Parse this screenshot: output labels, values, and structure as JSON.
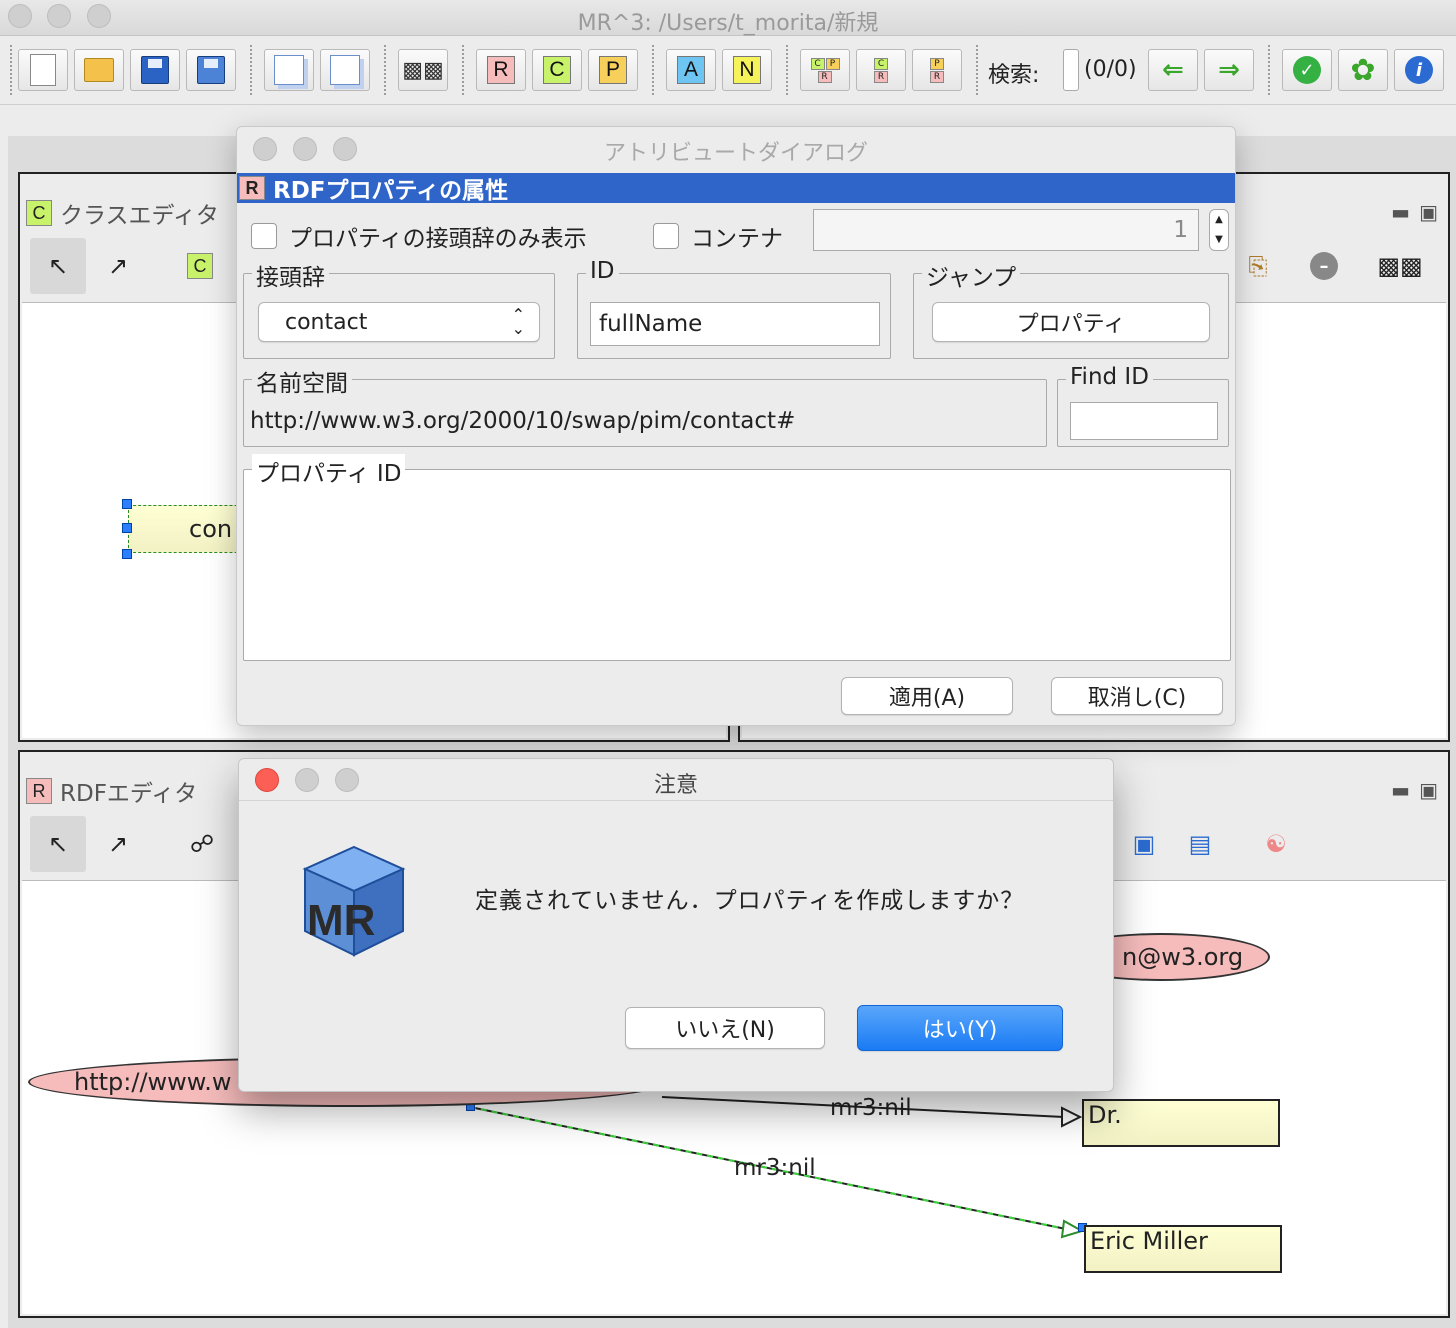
{
  "window": {
    "title": "MR^3: /Users/t_morita/新規"
  },
  "toolbar": {
    "letter_buttons": [
      "R",
      "C",
      "P",
      "A",
      "N"
    ],
    "combo_buttons": [
      {
        "top": "CP",
        "bottom": "R"
      },
      {
        "top": "C",
        "bottom": "R"
      },
      {
        "top": "P",
        "bottom": "R"
      }
    ],
    "search_label": "検索:",
    "search_value": "",
    "search_count": "(0/0)",
    "colors": {
      "R": "#f6bcbc",
      "C": "#c8f26a",
      "P": "#f6d05a",
      "A": "#6fc5f2",
      "N": "#f6f35a"
    }
  },
  "class_editor": {
    "badge": "C",
    "title": "クラスエディタ",
    "node_text": "con"
  },
  "rdf_editor": {
    "badge": "R",
    "title": "RDFエディタ",
    "nodes": {
      "email_partial": "n@w3.org",
      "url_partial": "http://www.w",
      "dr": "Dr.",
      "eric": "Eric Miller"
    },
    "edges": [
      "mr3:nil",
      "mr3:nil"
    ]
  },
  "attribute_dialog": {
    "title": "アトリビュートダイアログ",
    "header_badge": "R",
    "header": "RDFプロパティの属性",
    "show_prefix_only_label": "プロパティの接頭辞のみ表示",
    "container_label": "コンテナ",
    "container_value": "1",
    "prefix_group": "接頭辞",
    "prefix_value": "contact",
    "id_group": "ID",
    "id_value": "fullName",
    "jump_group": "ジャンプ",
    "jump_button": "プロパティ",
    "namespace_group": "名前空間",
    "namespace_value": "http://www.w3.org/2000/10/swap/pim/contact#",
    "find_id_group": "Find ID",
    "find_id_value": "",
    "property_id_group": "プロパティ ID",
    "apply_button": "適用(A)",
    "cancel_button": "取消し(C)"
  },
  "alert_dialog": {
    "title": "注意",
    "message": "定義されていません．プロパティを作成しますか？",
    "no_button": "いいえ(N)",
    "yes_button": "はい(Y)",
    "logo_text": "MR"
  }
}
